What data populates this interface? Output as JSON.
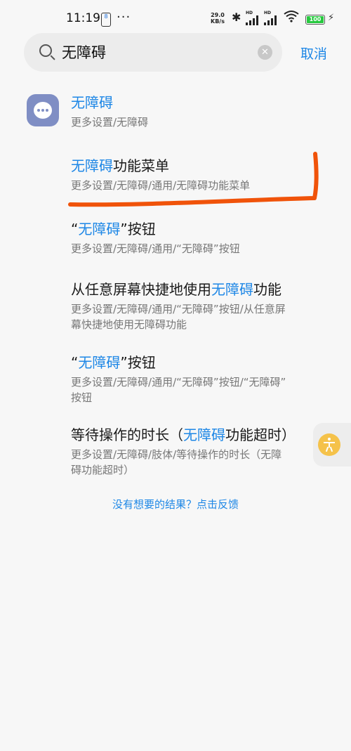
{
  "status_bar": {
    "time": "11:19",
    "notif_badge": "8",
    "net_speed_value": "29.0",
    "net_speed_unit": "KB/s",
    "sim1_label": "HD",
    "sim2_label": "HD",
    "battery": "100"
  },
  "search": {
    "query": "无障碍",
    "cancel_label": "取消"
  },
  "results": [
    {
      "title_pre": "",
      "title_hl": "无障碍",
      "title_post": "",
      "path": "更多设置/无障碍"
    },
    {
      "title_pre": "",
      "title_hl": "无障碍",
      "title_post": "功能菜单",
      "path": "更多设置/无障碍/通用/无障碍功能菜单"
    },
    {
      "title_pre": "“",
      "title_hl": "无障碍",
      "title_post": "”按钮",
      "path": "更多设置/无障碍/通用/“无障碍”按钮"
    },
    {
      "title_pre": "从任意屏幕快捷地使用",
      "title_hl": "无障碍",
      "title_post": "功能",
      "path_line1": "更多设置/无障碍/通用/“无障碍”按钮/从任意屏",
      "path_line2": "幕快捷地使用无障碍功能"
    },
    {
      "title_pre": "“",
      "title_hl": "无障碍",
      "title_post": "”按钮",
      "path_line1": "更多设置/无障碍/通用/“无障碍”按钮/“无障碍”",
      "path_line2": "按钮"
    },
    {
      "title_pre": "等待操作的时长（",
      "title_hl": "无障碍",
      "title_post": "功能超时）",
      "path_line1": "更多设置/无障碍/肢体/等待操作的时长（无障",
      "path_line2": "碍功能超时）"
    }
  ],
  "feedback": "没有想要的结果？点击反馈",
  "colors": {
    "accent": "#1e87e6",
    "annotation": "#f0530a",
    "app_icon": "#7f8ec4",
    "float_button": "#f5c24a"
  }
}
